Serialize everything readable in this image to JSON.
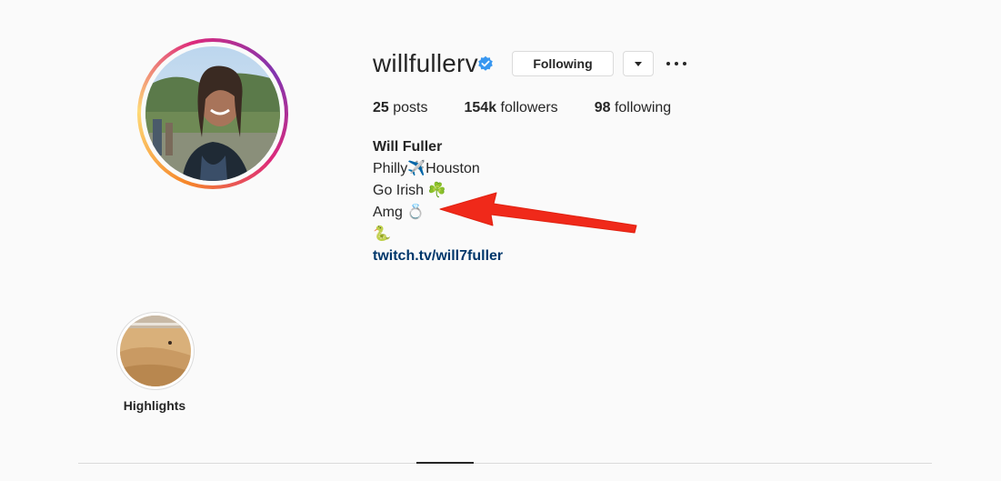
{
  "profile": {
    "username": "willfullerv",
    "following_label": "Following",
    "stats": {
      "posts_count": "25",
      "posts_label": "posts",
      "followers_count": "154k",
      "followers_label": "followers",
      "following_count": "98",
      "following_label": "following"
    },
    "bio": {
      "name": "Will Fuller",
      "line1": "Philly✈️Houston",
      "line2": "Go Irish ☘️",
      "line3": "Amg 💍",
      "line4": "🐍",
      "link": "twitch.tv/will7fuller"
    }
  },
  "highlights": [
    {
      "label": "Highlights"
    }
  ],
  "colors": {
    "verified": "#3897f0",
    "link": "#00376b",
    "arrow": "#f0291a"
  },
  "icons": {
    "verified": "verified-badge-icon",
    "dropdown": "chevron-down-icon",
    "more": "more-options-icon"
  }
}
